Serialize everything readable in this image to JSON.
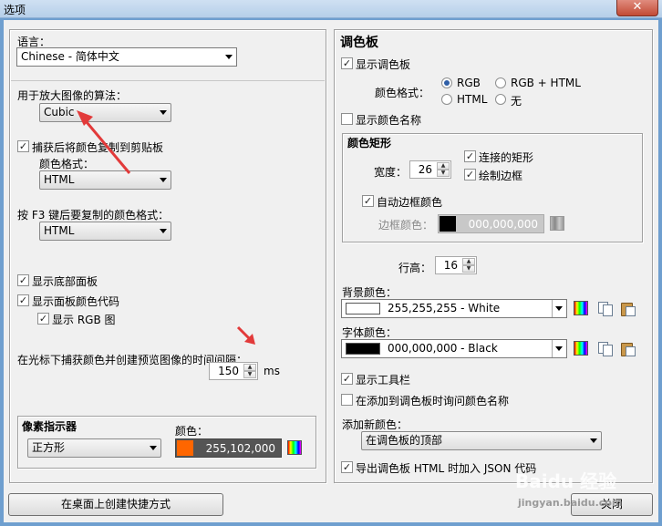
{
  "window": {
    "title": "选项",
    "close_glyph": "✕"
  },
  "left": {
    "language": {
      "label": "语言：",
      "value": "Chinese - 简体中文"
    },
    "algorithm": {
      "label": "用于放大图像的算法：",
      "value": "Cubic"
    },
    "copy_after_capture": {
      "label": "捕获后将颜色复制到剪贴板",
      "checked": true,
      "format_label": "颜色格式：",
      "format_value": "HTML"
    },
    "f3_format": {
      "label": "按 F3 键后要复制的颜色格式：",
      "value": "HTML"
    },
    "show_bottom_panel": {
      "label": "显示底部面板",
      "checked": true
    },
    "show_panel_code": {
      "label": "显示面板颜色代码",
      "checked": true
    },
    "show_rgb": {
      "label": "显示 RGB 图",
      "checked": true
    },
    "interval": {
      "label": "在光标下捕获颜色并创建预览图像的时间间隔：",
      "value": "150",
      "unit": "ms"
    },
    "pixel_indicator": {
      "title": "像素指示器",
      "shape": "正方形",
      "color_label": "颜色：",
      "color_value": "255,102,000",
      "color_hex": "#ff6600"
    },
    "shortcut_button": "在桌面上创建快捷方式"
  },
  "right": {
    "section_title": "调色板",
    "show_palette": {
      "label": "显示调色板",
      "checked": true
    },
    "color_format": {
      "label": "颜色格式：",
      "options": [
        "RGB",
        "RGB + HTML",
        "HTML",
        "无"
      ],
      "selected": "RGB"
    },
    "show_color_name": {
      "label": "显示颜色名称",
      "checked": false
    },
    "color_rect": {
      "title": "颜色矩形",
      "width_label": "宽度：",
      "width_value": "26",
      "connected": {
        "label": "连接的矩形",
        "checked": true
      },
      "draw_border": {
        "label": "绘制边框",
        "checked": true
      },
      "auto_border": {
        "label": "自动边框颜色",
        "checked": true
      },
      "border_color_label": "边框颜色：",
      "border_color_value": "000,000,000"
    },
    "row_height": {
      "label": "行高：",
      "value": "16"
    },
    "bg_color": {
      "label": "背景颜色：",
      "value": "255,255,255 - White",
      "hex": "#ffffff"
    },
    "font_color": {
      "label": "字体颜色：",
      "value": "000,000,000 - Black",
      "hex": "#000000"
    },
    "show_toolbar": {
      "label": "显示工具栏",
      "checked": true
    },
    "ask_name": {
      "label": "在添加到调色板时询问颜色名称",
      "checked": false
    },
    "add_new_color": {
      "label": "添加新颜色：",
      "value": "在调色板的顶部"
    },
    "export_json": {
      "label": "导出调色板 HTML 时加入 JSON 代码",
      "checked": true
    },
    "close_button": "关闭"
  },
  "watermark": {
    "brand": "Baidu 经验",
    "url": "jingyan.baidu.com"
  },
  "icons": {
    "window_close": "close-icon",
    "dropdown": "chevron-down-icon",
    "palette_picker": "color-palette-icon",
    "copy": "copy-icon",
    "paste": "paste-icon"
  },
  "colors": {
    "accent_arrow": "#e23a3a",
    "window_frame": "#6f9fcf"
  }
}
